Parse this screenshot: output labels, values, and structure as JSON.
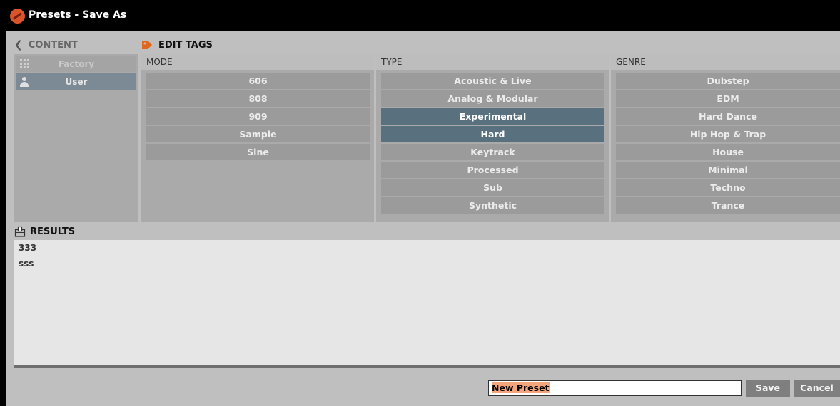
{
  "window": {
    "title": "Presets - Save As"
  },
  "content": {
    "label": "CONTENT",
    "items": [
      {
        "label": "Factory",
        "icon": "grid-icon",
        "selected": false
      },
      {
        "label": "User",
        "icon": "user-icon",
        "selected": true
      }
    ]
  },
  "edit_tags": {
    "label": "EDIT TAGS",
    "mode": {
      "header": "MODE",
      "tags": [
        "606",
        "808",
        "909",
        "Sample",
        "Sine"
      ],
      "selected": []
    },
    "type": {
      "header": "TYPE",
      "tags": [
        "Acoustic & Live",
        "Analog & Modular",
        "Experimental",
        "Hard",
        "Keytrack",
        "Processed",
        "Sub",
        "Synthetic"
      ],
      "selected": [
        "Experimental",
        "Hard"
      ]
    },
    "genre": {
      "header": "GENRE",
      "tags": [
        "Dubstep",
        "EDM",
        "Hard Dance",
        "Hip Hop & Trap",
        "House",
        "Minimal",
        "Techno",
        "Trance"
      ],
      "selected": []
    }
  },
  "results": {
    "label": "RESULTS",
    "items": [
      "333",
      "sss"
    ]
  },
  "footer": {
    "preset_name": "New Preset",
    "save_label": "Save",
    "cancel_label": "Cancel"
  },
  "colors": {
    "selected_tag": "#59707f",
    "selected_content": "#7c8a96",
    "tag_button": "#9b9b9b",
    "accent_orange": "#e0681e"
  }
}
